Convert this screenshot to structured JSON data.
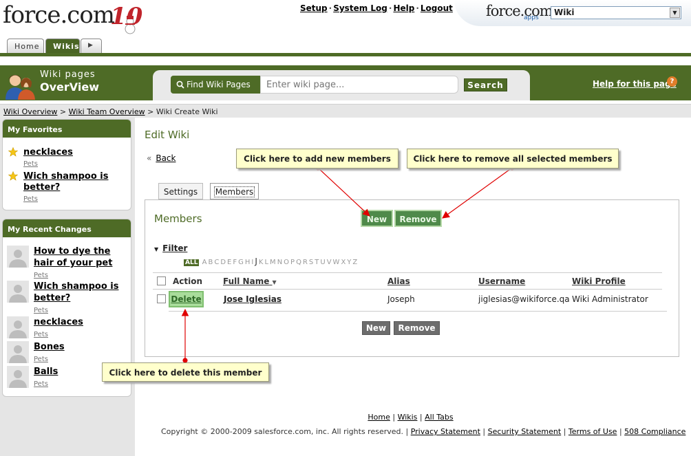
{
  "header": {
    "logo_text": "force.com",
    "logo_ten": "10",
    "links": [
      "Setup",
      "System Log",
      "Help",
      "Logout"
    ],
    "corner_logo": "force.com",
    "corner_apps": "apps",
    "app_select_value": "Wiki"
  },
  "tabs": {
    "home": "Home",
    "wikis": "Wikis"
  },
  "banner": {
    "line1": "Wiki pages",
    "line2": "OverView",
    "find_label": "Find Wiki Pages",
    "search_placeholder": "Enter wiki page...",
    "search_button": "Search",
    "help_link": "Help for this page",
    "help_icon": "?"
  },
  "breadcrumbs": {
    "item1": "Wiki Overview",
    "item2": "Wiki Team Overview",
    "item3": "Wiki Create Wiki",
    "sep": ">"
  },
  "sidebar": {
    "favorites_title": "My Favorites",
    "favorites": [
      {
        "title": "necklaces",
        "sub": "Pets"
      },
      {
        "title": "Wich shampoo is better?",
        "sub": "Pets"
      }
    ],
    "recent_title": "My Recent Changes",
    "recent": [
      {
        "title": "How to dye the hair of your pet",
        "sub": "Pets"
      },
      {
        "title": "Wich shampoo is better?",
        "sub": "Pets"
      },
      {
        "title": "necklaces",
        "sub": "Pets"
      },
      {
        "title": "Bones",
        "sub": "Pets"
      },
      {
        "title": "Balls",
        "sub": "Pets"
      }
    ]
  },
  "main": {
    "title": "Edit Wiki",
    "back": "Back",
    "back_arrow": "«",
    "tab_settings": "Settings",
    "tab_members": "Members",
    "section_title": "Members",
    "new_label": "New",
    "remove_label": "Remove",
    "filter_label": "Filter",
    "alpha_all": "ALL",
    "alphabet": [
      "A",
      "B",
      "C",
      "D",
      "E",
      "F",
      "G",
      "H",
      "I",
      "J",
      "K",
      "L",
      "M",
      "N",
      "O",
      "P",
      "Q",
      "R",
      "S",
      "T",
      "U",
      "V",
      "W",
      "X",
      "Y",
      "Z"
    ],
    "columns": {
      "action": "Action",
      "full_name": "Full Name",
      "alias": "Alias",
      "username": "Username",
      "profile": "Wiki Profile"
    },
    "rows": [
      {
        "action": "Delete",
        "full_name": "Jose Iglesias",
        "alias": "Joseph",
        "username": "jiglesias@wikiforce.qa",
        "profile": "Wiki Administrator"
      }
    ]
  },
  "callouts": {
    "add": "Click here to add new members",
    "remove": "Click here to remove all selected members",
    "delete": "Click here to delete this member"
  },
  "footer": {
    "links": [
      "Home",
      "Wikis",
      "All Tabs"
    ],
    "copyright": "Copyright © 2000-2009 salesforce.com, inc. All rights reserved. |",
    "legal": [
      "Privacy Statement",
      "Security Statement",
      "Terms of Use",
      "508 Compliance"
    ]
  },
  "colors": {
    "brand_green": "#4e6b26",
    "callout_bg": "#ffffcc",
    "arrow_red": "#e00000"
  }
}
